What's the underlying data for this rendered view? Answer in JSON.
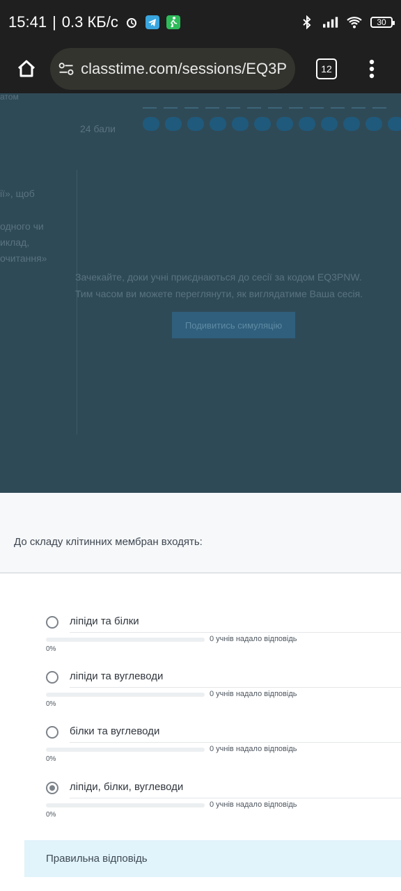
{
  "status": {
    "time": "15:41",
    "speed": "0.3 КБ/с",
    "battery": "30"
  },
  "browser": {
    "url": "classtime.com/sessions/EQ3P",
    "tab_count": "12"
  },
  "background": {
    "points_label": "24 бали",
    "left_snip_1": "ії», щоб",
    "left_snip_2": "одного чи",
    "left_snip_3": "иклад,",
    "left_snip_4": "очитання»",
    "top_snip": "атом",
    "waiting_line_1": "Зачекайте, доки учні приєднаються до сесії за кодом EQ3PNW.",
    "waiting_line_2": "Тим часом ви можете переглянути, як виглядатиме Ваша сесія.",
    "simulation_button": "Подивитись симуляцію"
  },
  "question": {
    "text": "До складу клітинних мембран входять:"
  },
  "options": [
    {
      "label": "ліпіди та білки",
      "count": "0 учнів надало відповідь",
      "percent": "0%",
      "fraction": 0,
      "checked": false
    },
    {
      "label": "ліпіди та вуглеводи",
      "count": "0 учнів надало відповідь",
      "percent": "0%",
      "fraction": 0,
      "checked": false
    },
    {
      "label": "білки та вуглеводи",
      "count": "0 учнів надало відповідь",
      "percent": "0%",
      "fraction": 0,
      "checked": false
    },
    {
      "label": "ліпіди, білки, вуглеводи",
      "count": "0 учнів надало відповідь",
      "percent": "0%",
      "fraction": 0,
      "checked": true
    }
  ],
  "correct_answer_label": "Правильна відповідь",
  "colors": {
    "dim_overlay": "#2f4a57",
    "accent": "#8cc4e6",
    "correct_bg": "#e1f3fb"
  }
}
